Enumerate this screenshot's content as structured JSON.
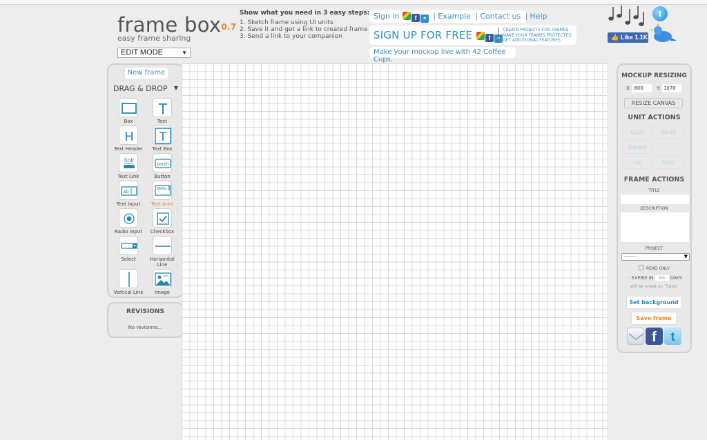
{
  "logo": {
    "title": "frame box",
    "version": "0.7",
    "tagline": "easy frame sharing"
  },
  "mode_select": {
    "value": "EDIT MODE"
  },
  "steps": {
    "heading": "Show what you need in 3 easy steps:",
    "items": [
      "1. Sketch frame using UI units",
      "2. Save it and get a link to created frame",
      "3. Send a link to your companion"
    ]
  },
  "top_links": {
    "sign_in": "Sign in",
    "example": "Example",
    "contact": "Contact us",
    "help": "Help",
    "separator": "|"
  },
  "signup": {
    "label": "SIGN UP FOR FREE",
    "features": [
      "CREATE PROJECTS FOR FRAMES",
      "MAKE YOUR FRAMES PROTECTED",
      "GET ADDITIONAL FEATURES"
    ]
  },
  "coffee": "Make your mockup live with 42 Coffee Cups.",
  "social": {
    "like_label": "Like 1.1K",
    "twitter_glyph": "t",
    "facebook_glyph": "f"
  },
  "left_panel": {
    "new_frame": "New frame",
    "drag_drop": "DRAG & DROP",
    "tools": [
      {
        "label": "Box",
        "icon": "box-icon"
      },
      {
        "label": "Text",
        "icon": "text-icon"
      },
      {
        "label": "Text Header",
        "icon": "text-header-icon"
      },
      {
        "label": "Text Box",
        "icon": "text-box-icon"
      },
      {
        "label": "Text Link",
        "icon": "text-link-icon"
      },
      {
        "label": "Button",
        "icon": "button-icon"
      },
      {
        "label": "Text Input",
        "icon": "text-input-icon"
      },
      {
        "label": "Text Area",
        "icon": "text-area-icon",
        "active": true
      },
      {
        "label": "Radio Input",
        "icon": "radio-icon"
      },
      {
        "label": "Checkbox",
        "icon": "checkbox-icon"
      },
      {
        "label": "Select",
        "icon": "select-icon"
      },
      {
        "label": "Horizontal Line",
        "icon": "horizontal-line-icon"
      },
      {
        "label": "Vertical Line",
        "icon": "vertical-line-icon"
      },
      {
        "label": "Image",
        "icon": "image-icon"
      }
    ],
    "icon_text": {
      "text": "T",
      "header": "H",
      "textbox": "T",
      "link": "link",
      "push": "push",
      "input": "ab"
    }
  },
  "revisions": {
    "title": "REVISIONS",
    "empty_text": "No revisions..."
  },
  "right_panel": {
    "resizing_title": "MOCKUP RESIZING",
    "x_label": "X:",
    "x_value": "800",
    "y_label": "Y:",
    "y_value": "1070",
    "resize_button": "RESIZE CANVAS",
    "unit_actions_title": "UNIT ACTIONS",
    "copy": "Copy",
    "paste": "Paste",
    "delete": "Delete",
    "up": "Up",
    "drop": "Drop",
    "frame_actions_title": "FRAME ACTIONS",
    "title_label": "TITLE",
    "title_value": "",
    "description_label": "DESCRIPTION",
    "description_value": "",
    "project_label": "PROJECT",
    "project_value": "---------",
    "read_only_label": "READ ONLY",
    "expire_label": "EXPIRE IN",
    "expire_value": "60",
    "days_label": "DAYS",
    "expire_note": "will be unset on \"Save\"",
    "set_background": "Set background",
    "save_frame": "Save frame"
  },
  "colors": {
    "accent_blue": "#3a8fb7",
    "accent_orange": "#e8872a",
    "facebook": "#3b5998",
    "twitter": "#2e8fd1"
  }
}
